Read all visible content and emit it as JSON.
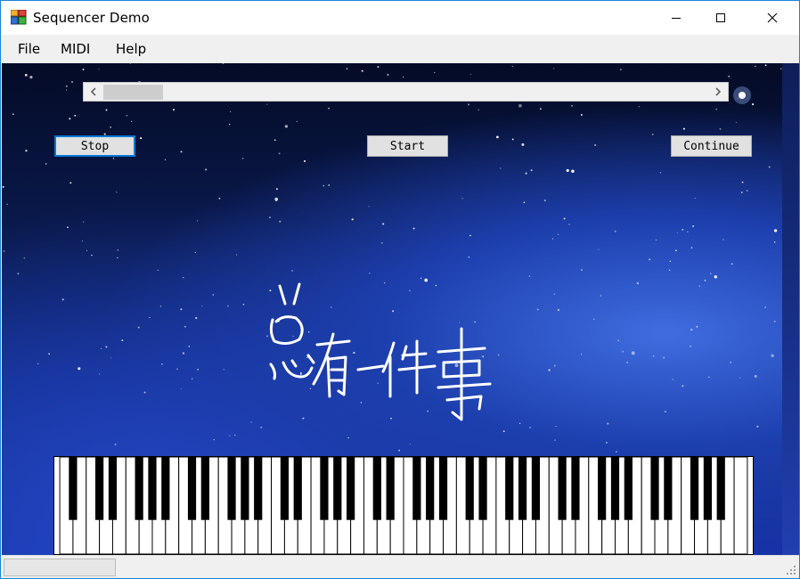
{
  "window": {
    "title": "Sequencer Demo"
  },
  "menu": {
    "items": [
      "File",
      "MIDI",
      "Help"
    ]
  },
  "buttons": {
    "stop": "Stop",
    "start": "Start",
    "continue": "Continue"
  },
  "scrollbar": {
    "position": 0.0
  },
  "piano": {
    "white_key_count": 52
  },
  "background": {
    "handwriting_text": "总有一件事"
  },
  "colors": {
    "accent": "#0078d7",
    "window_border": "#1883d7"
  }
}
